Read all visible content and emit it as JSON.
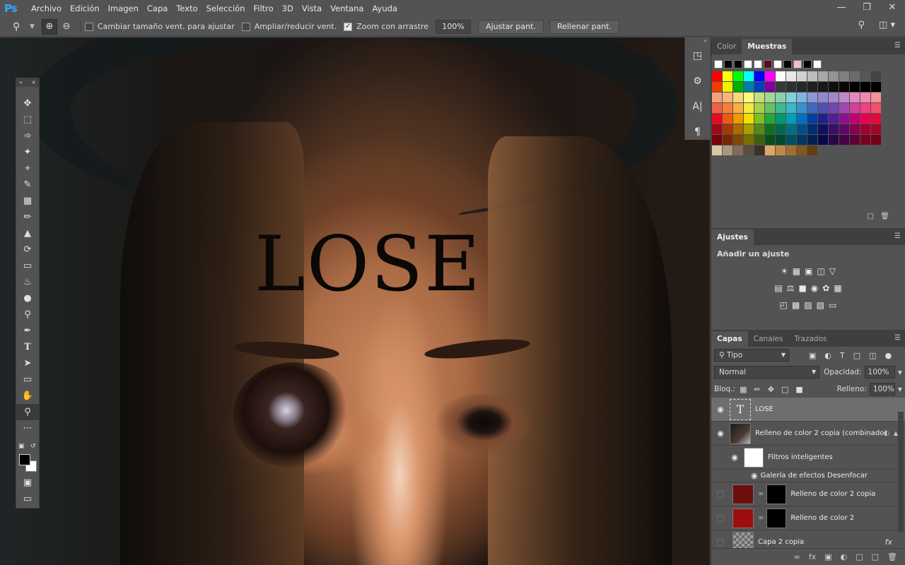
{
  "app": {
    "logo": "Ps"
  },
  "menu": [
    "Archivo",
    "Edición",
    "Imagen",
    "Capa",
    "Texto",
    "Selección",
    "Filtro",
    "3D",
    "Vista",
    "Ventana",
    "Ayuda"
  ],
  "window_controls": {
    "minimize": "—",
    "restore": "❐",
    "close": "✕"
  },
  "options": {
    "tool_icon": "zoom-icon",
    "resize_windows": {
      "label": "Cambiar tamaño vent. para ajustar",
      "checked": false
    },
    "zoom_all": {
      "label": "Ampliar/reducir vent.",
      "checked": false
    },
    "scrubby_zoom": {
      "label": "Zoom con arrastre",
      "checked": true
    },
    "zoom_level": "100%",
    "fit_screen": "Ajustar pant.",
    "fill_screen": "Rellenar pant."
  },
  "canvas": {
    "text_layer": "LOSE"
  },
  "panels": {
    "swatches_tabs": [
      "Color",
      "Muestras"
    ],
    "adjustments_tab": "Ajustes",
    "adjustments_title": "Añadir un ajuste",
    "layers_tabs": [
      "Capas",
      "Canales",
      "Trazados"
    ],
    "filter_kind": "Tipo",
    "blend_mode": "Normal",
    "opacity_label": "Opacidad:",
    "opacity_value": "100%",
    "lock_label": "Bloq.:",
    "fill_label": "Relleno:",
    "fill_value": "100%",
    "layers": [
      {
        "name": "LOSE",
        "visible": true,
        "selected": true,
        "kind": "text"
      },
      {
        "name": "Relleno de color 2 copia (combinado)",
        "visible": true,
        "kind": "smart"
      },
      {
        "name": "Filtros inteligentes",
        "visible": true,
        "kind": "filter-mask"
      },
      {
        "name": "Galería de efectos Desenfocar",
        "visible": true,
        "kind": "filter"
      },
      {
        "name": "Relleno de color 2 copia",
        "visible": false,
        "kind": "fill"
      },
      {
        "name": "Relleno de color 2",
        "visible": false,
        "kind": "fill"
      },
      {
        "name": "Capa 2 copia",
        "visible": false,
        "kind": "pixel"
      }
    ],
    "colors": {
      "accent": "#31a8ff",
      "fill_dark_red": "#6a0e0e",
      "fill_red": "#9e0e0e"
    }
  }
}
